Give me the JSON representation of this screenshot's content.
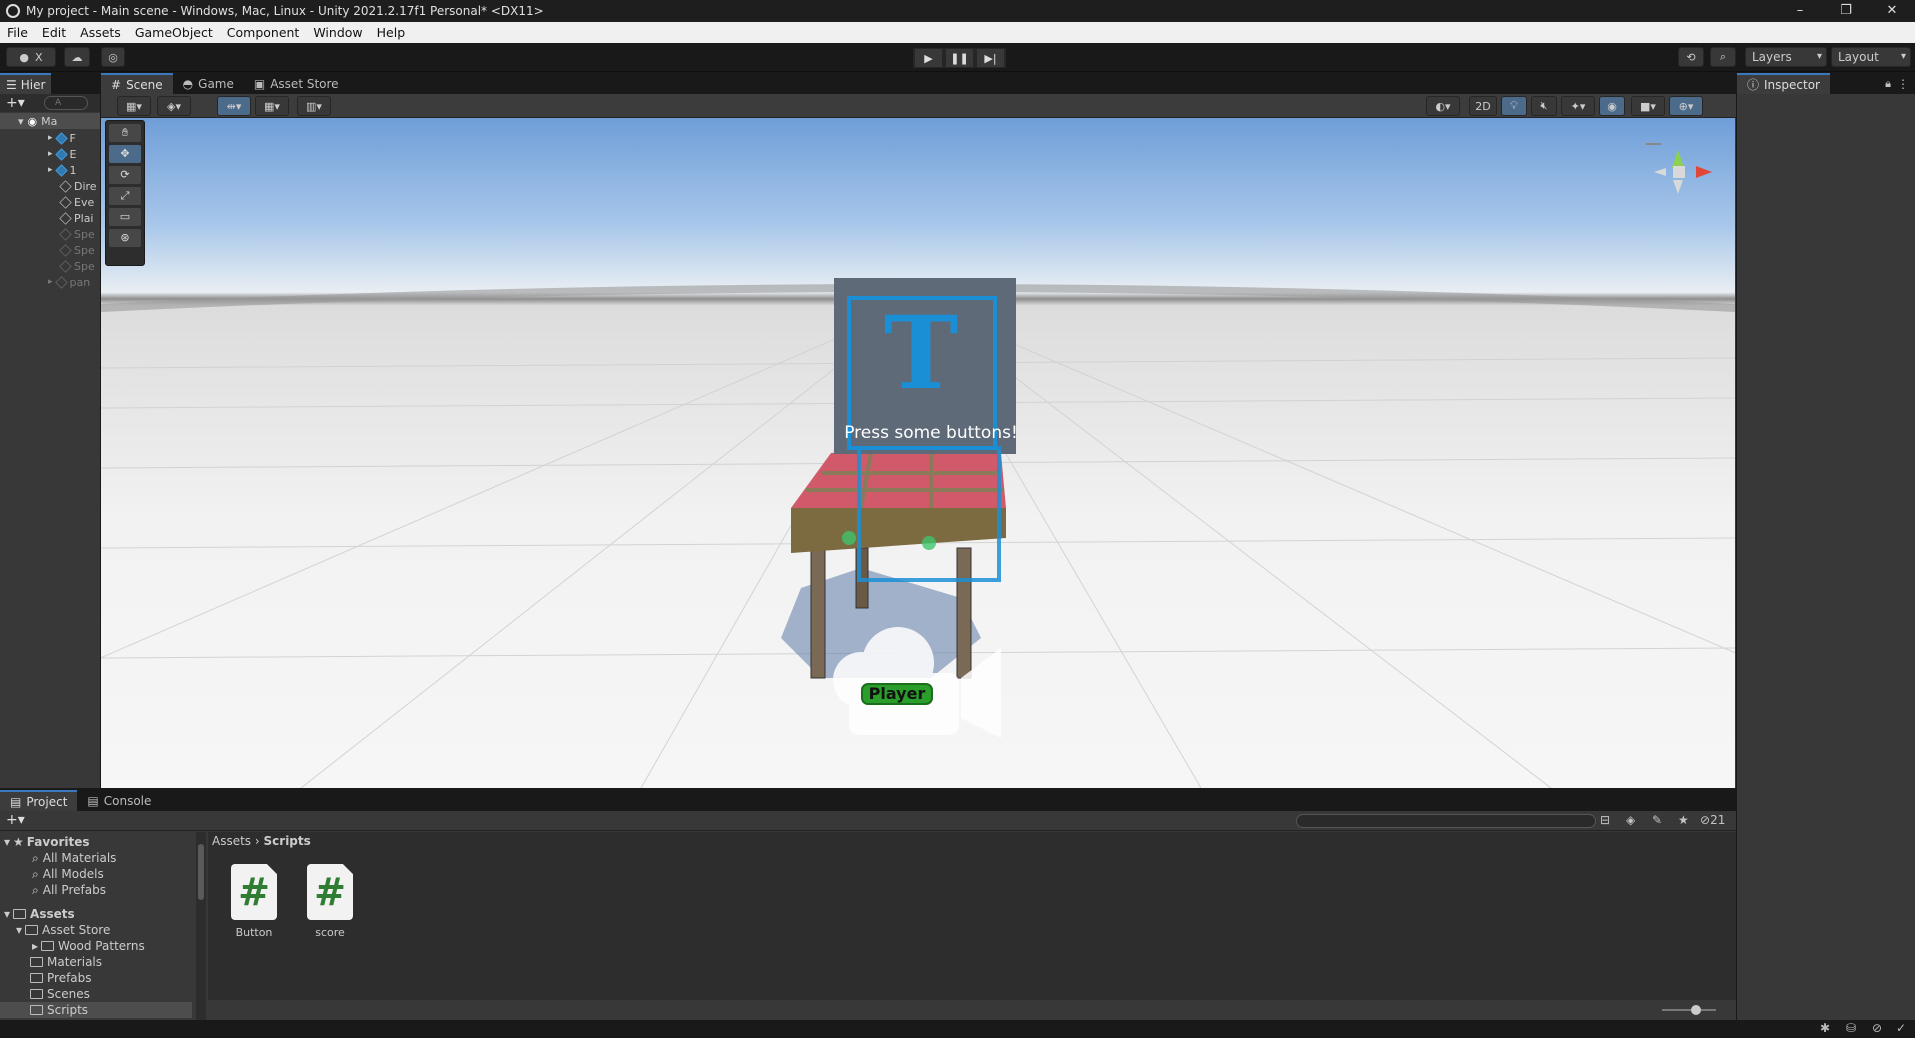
{
  "window": {
    "title": "My project - Main scene - Windows, Mac, Linux - Unity 2021.2.17f1 Personal* <DX11>",
    "controls": [
      "–",
      "❐",
      "✕"
    ]
  },
  "menu": [
    "File",
    "Edit",
    "Assets",
    "GameObject",
    "Component",
    "Window",
    "Help"
  ],
  "toolbar": {
    "account_label": "X",
    "layers_label": "Layers",
    "layout_label": "Layout"
  },
  "hierarchy": {
    "tab_label": "Hier",
    "search_placeholder": "A",
    "root": "Ma",
    "items": [
      {
        "label": "F",
        "kind": "prefab"
      },
      {
        "label": "E",
        "kind": "prefab"
      },
      {
        "label": "1",
        "kind": "prefab"
      },
      {
        "label": "Dire",
        "kind": "object"
      },
      {
        "label": "Eve",
        "kind": "object"
      },
      {
        "label": "Plai",
        "kind": "object"
      },
      {
        "label": "Spe",
        "kind": "object-dim"
      },
      {
        "label": "Spe",
        "kind": "object-dim"
      },
      {
        "label": "Spe",
        "kind": "object-dim"
      },
      {
        "label": "pan",
        "kind": "object-dim"
      }
    ]
  },
  "scene": {
    "tabs": [
      "Scene",
      "Game",
      "Asset Store"
    ],
    "mode_2d": "2D",
    "ui_text": "Press some buttons!",
    "player_label": "Player"
  },
  "inspector": {
    "tab_label": "Inspector"
  },
  "project": {
    "tabs": [
      "Project",
      "Console"
    ],
    "hidden_count": "21",
    "breadcrumb": [
      "Assets",
      "Scripts"
    ],
    "favorites_label": "Favorites",
    "favorites": [
      "All Materials",
      "All Models",
      "All Prefabs"
    ],
    "assets_label": "Assets",
    "asset_tree": [
      "Asset Store",
      "Wood Patterns",
      "Materials",
      "Prefabs",
      "Scenes",
      "Scripts"
    ],
    "files": [
      {
        "name": "Button",
        "glyph": "#"
      },
      {
        "name": "score",
        "glyph": "#"
      }
    ]
  },
  "colors": {
    "accent": "#3a79bb",
    "script_icon": "#2e7d32",
    "player_badge": "#2a9d2a"
  }
}
